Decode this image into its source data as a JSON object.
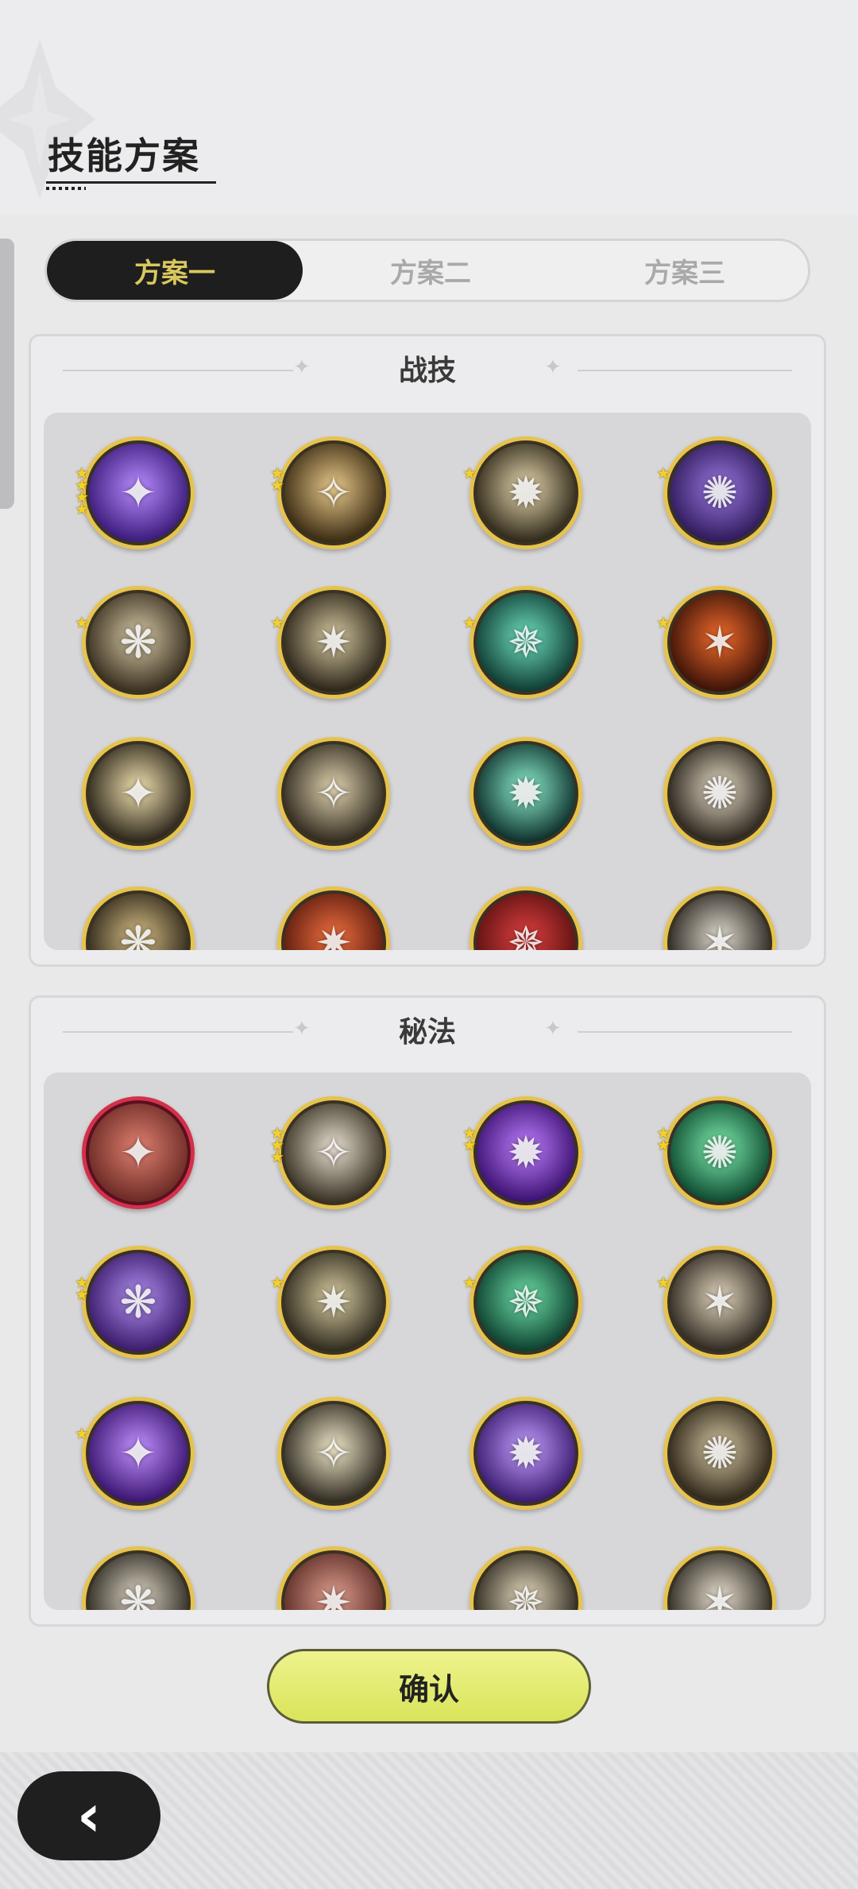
{
  "header": {
    "title": "技能方案"
  },
  "tabs": [
    {
      "label": "方案一",
      "active": true
    },
    {
      "label": "方案二",
      "active": false
    },
    {
      "label": "方案三",
      "active": false
    }
  ],
  "sections": [
    {
      "title": "战技",
      "icons": [
        {
          "name": "purple-heart-skill-icon",
          "stars": 4,
          "colors": [
            "#3a1a7a",
            "#b98cff"
          ]
        },
        {
          "name": "golden-slash-skill-icon",
          "stars": 2,
          "colors": [
            "#3a2a12",
            "#e8c98a"
          ]
        },
        {
          "name": "light-pillar-skill-icon",
          "stars": 1,
          "colors": [
            "#2e2818",
            "#e8d8b0"
          ]
        },
        {
          "name": "purple-claw-skill-icon",
          "stars": 1,
          "colors": [
            "#2e1a5a",
            "#9a78e0"
          ]
        },
        {
          "name": "grab-hand-skill-icon",
          "stars": 1,
          "colors": [
            "#3a3020",
            "#d8caa8"
          ]
        },
        {
          "name": "sword-swing-skill-icon",
          "stars": 1,
          "colors": [
            "#2a2418",
            "#d6c8a0"
          ]
        },
        {
          "name": "green-sword-skill-icon",
          "stars": 1,
          "colors": [
            "#0e3a32",
            "#6fe0c0"
          ]
        },
        {
          "name": "fire-ring-skill-icon",
          "stars": 1,
          "colors": [
            "#3a1208",
            "#f06a2a"
          ]
        },
        {
          "name": "burst-skill-icon",
          "stars": 0,
          "colors": [
            "#2a2418",
            "#f0e0b0"
          ]
        },
        {
          "name": "whirlwind-skill-icon",
          "stars": 0,
          "colors": [
            "#302a1e",
            "#e0d2b0"
          ]
        },
        {
          "name": "green-crescent-skill-icon",
          "stars": 0,
          "colors": [
            "#0c2e2a",
            "#8ef0d0"
          ]
        },
        {
          "name": "cross-blades-skill-icon",
          "stars": 0,
          "colors": [
            "#2a241c",
            "#e6dcc6"
          ]
        },
        {
          "name": "partial-skill-icon-1",
          "stars": 0,
          "colors": [
            "#2e2618",
            "#d8c088"
          ]
        },
        {
          "name": "partial-skill-icon-2",
          "stars": 0,
          "colors": [
            "#5a1a0e",
            "#f07040"
          ]
        },
        {
          "name": "partial-skill-icon-3",
          "stars": 0,
          "colors": [
            "#5a1010",
            "#e04040"
          ]
        },
        {
          "name": "partial-skill-icon-4",
          "stars": 0,
          "colors": [
            "#2a2620",
            "#e0dcd0"
          ]
        }
      ]
    },
    {
      "title": "秘法",
      "icons": [
        {
          "name": "red-fist-secret-icon",
          "stars": 0,
          "red": true,
          "colors": [
            "#6a2a24",
            "#e08070"
          ]
        },
        {
          "name": "blade-secret-icon",
          "stars": 3,
          "colors": [
            "#3a3224",
            "#e8e0d0"
          ]
        },
        {
          "name": "purple-flame-secret-icon",
          "stars": 2,
          "colors": [
            "#3a1070",
            "#c080ff"
          ]
        },
        {
          "name": "green-heart-secret-icon",
          "stars": 2,
          "colors": [
            "#0e4a30",
            "#7ef0b0"
          ]
        },
        {
          "name": "purple-wolf-secret-icon",
          "stars": 2,
          "colors": [
            "#3a1a6a",
            "#b090f0"
          ]
        },
        {
          "name": "leaf-secret-icon",
          "stars": 1,
          "colors": [
            "#2e2a1e",
            "#d8cca0"
          ]
        },
        {
          "name": "green-heal-secret-icon",
          "stars": 1,
          "colors": [
            "#0c3e2e",
            "#6ee0a8"
          ]
        },
        {
          "name": "sword-up-secret-icon",
          "stars": 1,
          "colors": [
            "#2e2820",
            "#e0d4bc"
          ]
        },
        {
          "name": "purple-figure-secret-icon",
          "stars": 1,
          "colors": [
            "#3a1470",
            "#c090ff"
          ]
        },
        {
          "name": "eye-secret-icon",
          "stars": 0,
          "colors": [
            "#2e2a20",
            "#efe6c8"
          ]
        },
        {
          "name": "purple-orb-secret-icon",
          "stars": 0,
          "colors": [
            "#3a1a70",
            "#c4a0ff"
          ]
        },
        {
          "name": "beast-secret-icon",
          "stars": 0,
          "colors": [
            "#2e2618",
            "#d6c8a4"
          ]
        },
        {
          "name": "partial-secret-icon-1",
          "stars": 0,
          "colors": [
            "#2e2a22",
            "#e0d8c8"
          ]
        },
        {
          "name": "partial-secret-icon-2",
          "stars": 0,
          "colors": [
            "#5a2a24",
            "#e0a090"
          ]
        },
        {
          "name": "partial-secret-icon-3",
          "stars": 0,
          "colors": [
            "#2e2a20",
            "#e8dcc0"
          ]
        },
        {
          "name": "partial-secret-icon-4",
          "stars": 0,
          "colors": [
            "#2e2a22",
            "#e8e0d0"
          ]
        }
      ]
    }
  ],
  "confirm": {
    "label": "确认"
  },
  "back": {
    "icon": "chevron-left-icon"
  },
  "theme": {
    "accent": "#d8c85e",
    "button": "#e4ea72",
    "ring": "#e6c34d",
    "ring_special": "#d4304a"
  }
}
